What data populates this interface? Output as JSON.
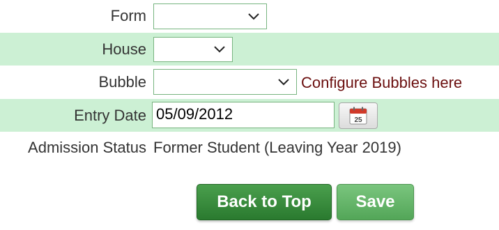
{
  "form": {
    "form_field": {
      "label": "Form",
      "value": ""
    },
    "house_field": {
      "label": "House",
      "value": ""
    },
    "bubble_field": {
      "label": "Bubble",
      "value": "",
      "link_text": "Configure Bubbles here"
    },
    "entry_date": {
      "label": "Entry Date",
      "value": "05/09/2012",
      "calendar_day": "25"
    },
    "admission_status": {
      "label": "Admission Status",
      "value": "Former Student (Leaving Year 2019)"
    }
  },
  "actions": {
    "back_to_top": "Back to Top",
    "save": "Save"
  },
  "colors": {
    "row_shade": "#ccf0d4",
    "primary_button": "#2f8434",
    "secondary_button": "#5fb163",
    "link": "#6b0f0f"
  }
}
